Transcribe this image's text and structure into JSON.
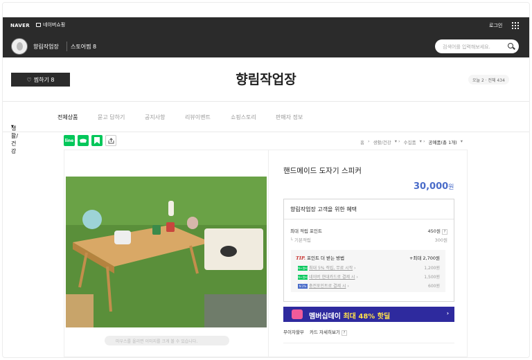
{
  "gnb": {
    "logo": "NAVER",
    "shopping": "네이버쇼핑",
    "login": "로그인",
    "store_name": "향림작업장",
    "zzim": "스토어찜 8",
    "search_placeholder": "검색어를 입력해보세요."
  },
  "title": {
    "zzim_button": "찜하기 8",
    "store_title": "향림작업장",
    "visit": "오늘 2 · 전체 434"
  },
  "menu": [
    "생활/건강",
    "전체상품",
    "묻고 답하기",
    "공지사항",
    "리뷰이벤트",
    "쇼핑스토리",
    "판매자 정보"
  ],
  "tools": {
    "line": "line",
    "kakao": "kakao",
    "bookmark": "bookmark",
    "share": "share"
  },
  "breadcrumb": [
    "홈",
    "생활/건강",
    "수집품",
    "공예품(총 1개)"
  ],
  "product": {
    "title": "핸드메이드 도자기 스피커",
    "price": "30,000",
    "won": "원",
    "photo_hint": "마우스를 올리면 이미지를 크게 볼 수 있습니다.",
    "benefit_title": "향림작업장 고객을 위한 혜택",
    "max_point_label": "최대 적립 포인트",
    "max_point": "450원",
    "basic_label": "기본적립",
    "basic_value": "300원",
    "tip_label": "TIP.",
    "tip_title": "포인트 더 받는 방법",
    "tip_max": "+최대 2,700원",
    "tips": [
      {
        "badge": "N+멤버십",
        "text": "최대 5% 적립, 무료 시작",
        "value": "1,200원"
      },
      {
        "badge": "N+멤버십",
        "text": "네이버 현대카드로 결제 시",
        "value": "1,500원"
      },
      {
        "badge": "N 2%",
        "text": "충전포인트로 결제 시",
        "value": "600원"
      }
    ],
    "banner_text": "멤버십데이",
    "banner_highlight": "최대 48% 핫딜",
    "shipping": "무이자할부",
    "card_detail": "카드 자세히보기"
  },
  "colors": {
    "dark": "#2b2b2b",
    "price": "#4a6cc9",
    "banner": "#2e2a9e",
    "naver_green": "#03c75a"
  }
}
